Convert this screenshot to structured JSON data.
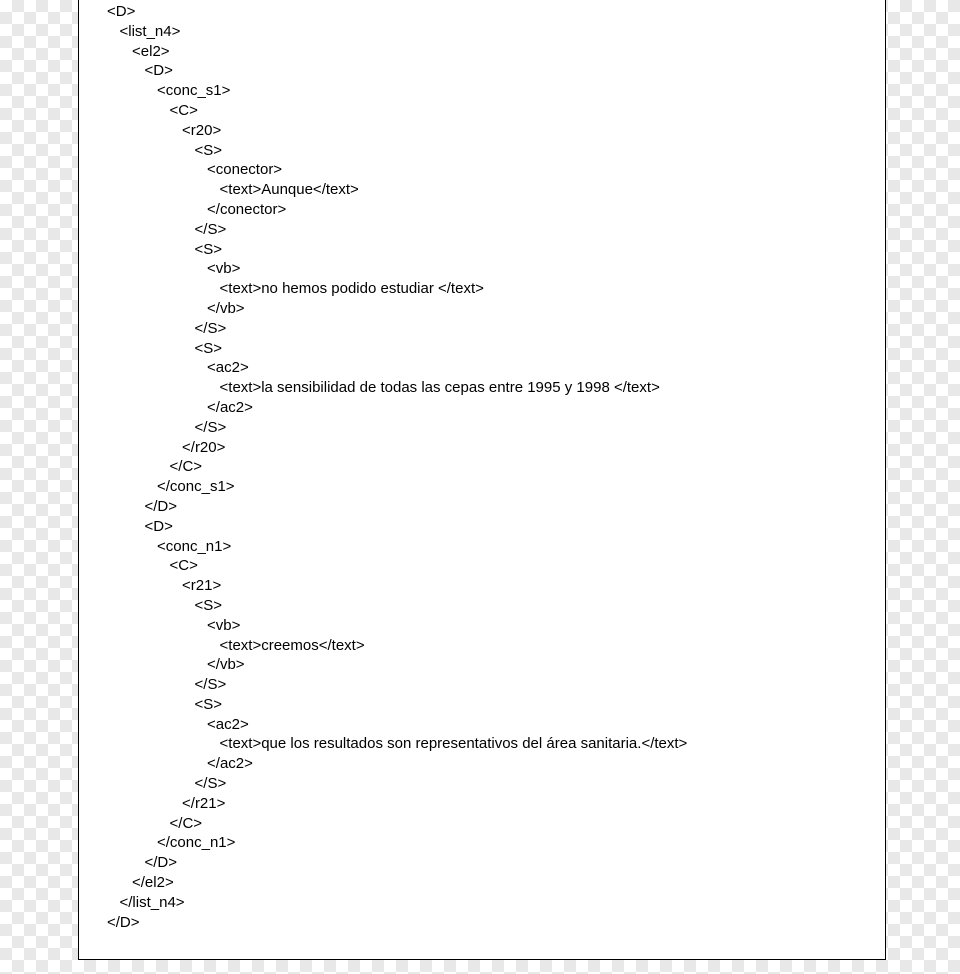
{
  "lines": [
    {
      "indent": 0,
      "text": "<D>"
    },
    {
      "indent": 1,
      "text": "<list_n4>"
    },
    {
      "indent": 2,
      "text": "<el2>"
    },
    {
      "indent": 3,
      "text": "<D>"
    },
    {
      "indent": 4,
      "text": "<conc_s1>"
    },
    {
      "indent": 5,
      "text": "<C>"
    },
    {
      "indent": 6,
      "text": "<r20>"
    },
    {
      "indent": 7,
      "text": "<S>"
    },
    {
      "indent": 8,
      "text": "<conector>"
    },
    {
      "indent": 9,
      "text": "<text>Aunque</text>"
    },
    {
      "indent": 8,
      "text": "</conector>"
    },
    {
      "indent": 7,
      "text": "</S>"
    },
    {
      "indent": 7,
      "text": "<S>"
    },
    {
      "indent": 8,
      "text": "<vb>"
    },
    {
      "indent": 9,
      "text": "<text>no hemos podido estudiar </text>"
    },
    {
      "indent": 8,
      "text": "</vb>"
    },
    {
      "indent": 7,
      "text": "</S>"
    },
    {
      "indent": 7,
      "text": "<S>"
    },
    {
      "indent": 8,
      "text": "<ac2>"
    },
    {
      "indent": 9,
      "text": "<text>la sensibilidad de todas las cepas entre 1995 y 1998 </text>"
    },
    {
      "indent": 8,
      "text": "</ac2>"
    },
    {
      "indent": 7,
      "text": "</S>"
    },
    {
      "indent": 6,
      "text": "</r20>"
    },
    {
      "indent": 5,
      "text": "</C>"
    },
    {
      "indent": 4,
      "text": "</conc_s1>"
    },
    {
      "indent": 3,
      "text": "</D>"
    },
    {
      "indent": 3,
      "text": "<D>"
    },
    {
      "indent": 4,
      "text": "<conc_n1>"
    },
    {
      "indent": 5,
      "text": "<C>"
    },
    {
      "indent": 6,
      "text": "<r21>"
    },
    {
      "indent": 7,
      "text": "<S>"
    },
    {
      "indent": 8,
      "text": "<vb>"
    },
    {
      "indent": 9,
      "text": "<text>creemos</text>"
    },
    {
      "indent": 8,
      "text": "</vb>"
    },
    {
      "indent": 7,
      "text": "</S>"
    },
    {
      "indent": 7,
      "text": "<S>"
    },
    {
      "indent": 8,
      "text": "<ac2>"
    },
    {
      "indent": 9,
      "text": "<text>que los resultados son representativos del área sanitaria.</text>"
    },
    {
      "indent": 8,
      "text": "</ac2>"
    },
    {
      "indent": 7,
      "text": "</S>"
    },
    {
      "indent": 6,
      "text": "</r21>"
    },
    {
      "indent": 5,
      "text": "</C>"
    },
    {
      "indent": 4,
      "text": "</conc_n1>"
    },
    {
      "indent": 3,
      "text": "</D>"
    },
    {
      "indent": 2,
      "text": "</el2>"
    },
    {
      "indent": 1,
      "text": "</list_n4>"
    },
    {
      "indent": 0,
      "text": "</D>"
    }
  ],
  "indent_unit": "   "
}
